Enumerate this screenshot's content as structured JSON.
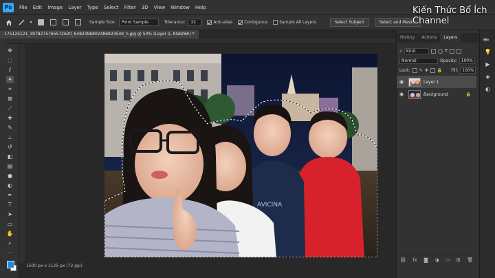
{
  "app": {
    "logo": "Ps"
  },
  "menu": [
    "File",
    "Edit",
    "Image",
    "Layer",
    "Type",
    "Select",
    "Filter",
    "3D",
    "View",
    "Window",
    "Help"
  ],
  "watermark": {
    "line1": "Kiến Thức Bổ Ích",
    "line2": "Channel"
  },
  "options": {
    "sample_size_label": "Sample Size:",
    "sample_size_value": "Point Sample",
    "tolerance_label": "Tolerance:",
    "tolerance_value": "32",
    "anti_alias_label": "Anti-alias",
    "anti_alias_checked": true,
    "contiguous_label": "Contiguous",
    "contiguous_checked": true,
    "sample_all_layers_label": "Sample All Layers",
    "sample_all_layers_checked": false,
    "select_subject_label": "Select Subject",
    "select_and_mask_label": "Select and Mask..."
  },
  "document": {
    "tab_title": "175125121_3978275765572620_6482396802486923549_n.jpg @ 50% (Layer 1, RGB/8#) *",
    "status": "1500 px x 1125 px (72 ppi)"
  },
  "panels": {
    "tabs": [
      {
        "label": "History",
        "active": false
      },
      {
        "label": "Actions",
        "active": false
      },
      {
        "label": "Layers",
        "active": true
      }
    ],
    "kind_label": "Kind",
    "blend_mode": "Normal",
    "opacity_label": "Opacity:",
    "opacity_value": "100%",
    "lock_label": "Lock:",
    "fill_label": "Fill:",
    "fill_value": "100%",
    "layers": [
      {
        "name": "Layer 1",
        "selected": true,
        "locked": false
      },
      {
        "name": "Background",
        "selected": false,
        "locked": true
      }
    ]
  },
  "colors": {
    "foreground": "#1c8adb",
    "background": "#ffffff",
    "accent": "#31a8ff"
  }
}
